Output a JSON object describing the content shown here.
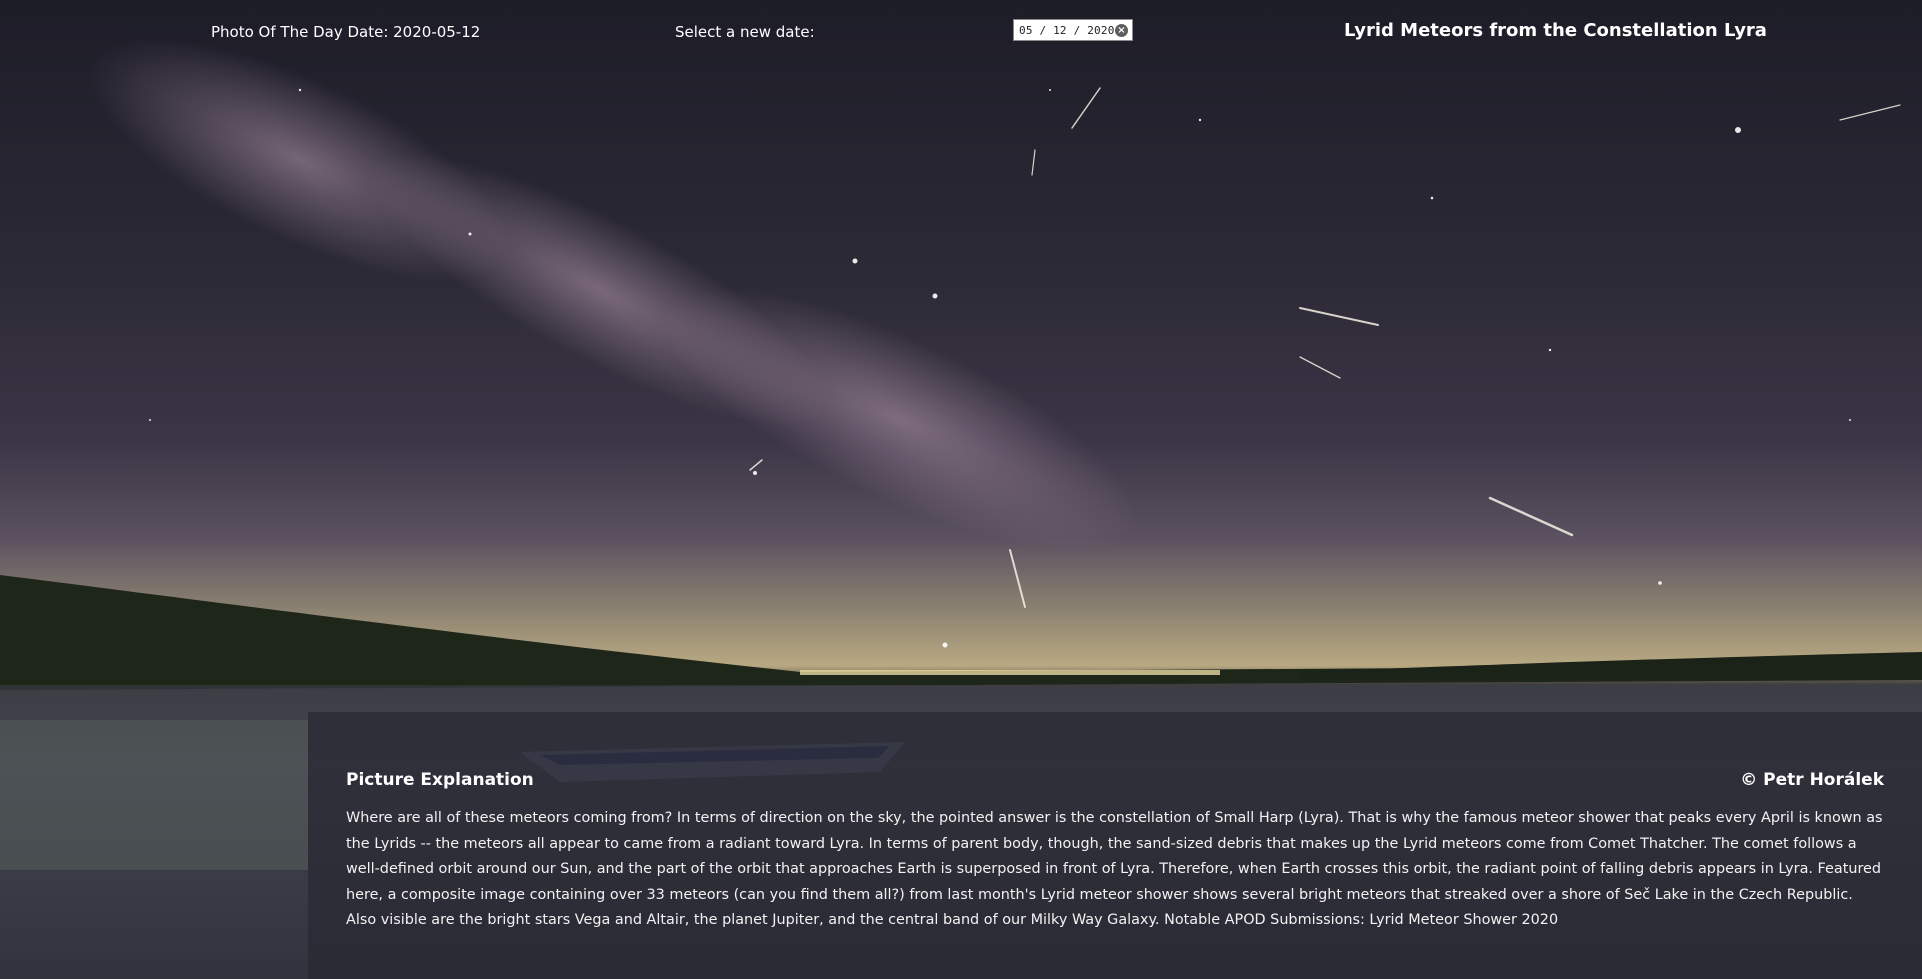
{
  "header": {
    "photo_date_label": "Photo Of The Day Date: 2020-05-12",
    "select_label": "Select a new date:",
    "date_value": "05 / 12 / 2020",
    "clear_icon": "clear-icon",
    "title": "Lyrid Meteors from the Constellation Lyra"
  },
  "explanation": {
    "heading": "Picture Explanation",
    "copyright": "© Petr Horálek",
    "text": "Where are all of these meteors coming from? In terms of direction on the sky, the pointed answer is the constellation of Small Harp (Lyra). That is why the famous meteor shower that peaks every April is known as the Lyrids -- the meteors all appear to came from a radiant toward Lyra. In terms of parent body, though, the sand-sized debris that makes up the Lyrid meteors come from Comet Thatcher. The comet follows a well-defined orbit around our Sun, and the part of the orbit that approaches Earth is superposed in front of Lyra. Therefore, when Earth crosses this orbit, the radiant point of falling debris appears in Lyra. Featured here, a composite image containing over 33 meteors (can you find them all?) from last month's Lyrid meteor shower shows several bright meteors that streaked over a shore of Seč Lake in the Czech Republic. Also visible are the bright stars Vega and Altair, the planet Jupiter, and the central band of our Milky Way Galaxy. Notable APOD Submissions: Lyrid Meteor Shower 2020"
  },
  "colors": {
    "sky_top": "#1f1f2b",
    "sky_mid": "#3b3346",
    "horizon_glow": "#b9ab84",
    "water": "#3d3c4c",
    "panel": "#28283280"
  }
}
